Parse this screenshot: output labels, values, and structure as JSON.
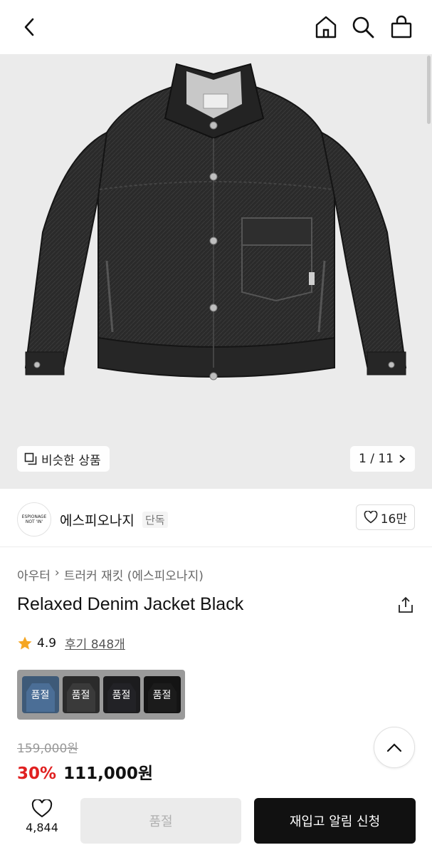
{
  "header": {
    "back_icon": "chevron-left-icon",
    "home_icon": "home-icon",
    "search_icon": "search-icon",
    "bag_icon": "shopping-bag-icon"
  },
  "hero": {
    "similar_label": "비슷한 상품",
    "counter": "1 / 11"
  },
  "brand": {
    "logo_line1": "ESPIONAGE",
    "logo_line2": "NOT 'IN'",
    "name": "에스피오나지",
    "badge": "단독",
    "like_count": "16만"
  },
  "product": {
    "breadcrumb": [
      "아우터",
      "트러커 재킷 (에스피오나지)"
    ],
    "title": "Relaxed Denim Jacket Black",
    "rating": "4.9",
    "reviews": "후기 848개",
    "colors": [
      {
        "label": "품절",
        "color": "#3e5a78"
      },
      {
        "label": "품절",
        "color": "#2b2b2b"
      },
      {
        "label": "품절",
        "color": "#1c1c1e"
      },
      {
        "label": "품절",
        "color": "#141414"
      }
    ],
    "original_price": "159,000원",
    "discount": "30%",
    "price": "111,000원"
  },
  "bottom": {
    "wish_count": "4,844",
    "soldout_label": "품절",
    "restock_label": "재입고 알림 신청"
  },
  "colors": {
    "accent_red": "#e02020",
    "cta_black": "#111111",
    "star": "#f5a623"
  }
}
